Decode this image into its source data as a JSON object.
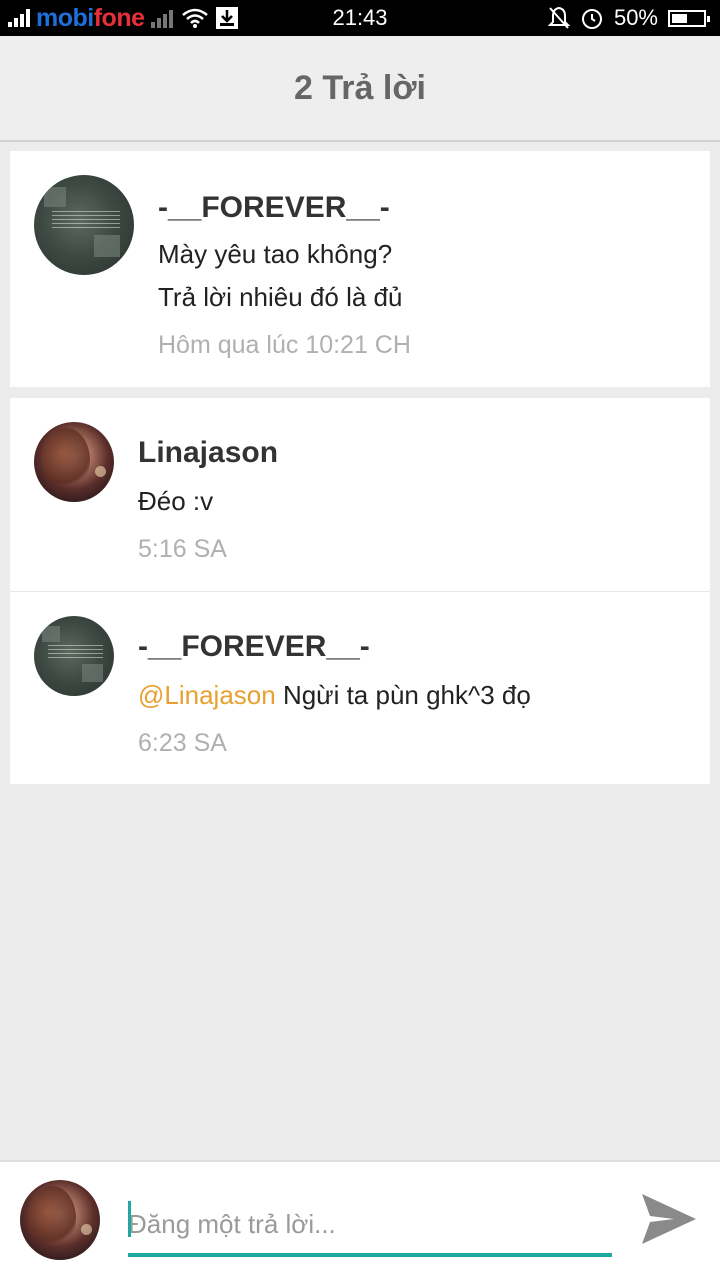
{
  "status_bar": {
    "carrier_left": "mobi",
    "carrier_right": "fone",
    "time": "21:43",
    "battery_percent": "50%",
    "battery_level": 0.5,
    "icons": [
      "signal-icon",
      "wifi-icon",
      "download-icon",
      "mute-bell-icon",
      "alarm-icon",
      "battery-icon"
    ]
  },
  "header": {
    "title": "2 Trả lời"
  },
  "post": {
    "author": "-__FOREVER__-",
    "lines": [
      "Mày yêu tao không?",
      "Trả lời nhiêu đó là đủ"
    ],
    "time": "Hôm qua lúc 10:21 CH"
  },
  "replies": [
    {
      "author": "Linajason",
      "mention": "",
      "text": "Đéo :v",
      "time": "5:16 SA"
    },
    {
      "author": "-__FOREVER__-",
      "mention": "@Linajason",
      "text": " Ngừi ta pùn ghk^3 đọ",
      "time": "6:23 SA"
    }
  ],
  "composer": {
    "placeholder": "Đăng một trả lời..."
  },
  "colors": {
    "accent": "#20a9a3",
    "mention": "#e8a030",
    "appbar": "#eeeeee",
    "background": "#ececec"
  }
}
